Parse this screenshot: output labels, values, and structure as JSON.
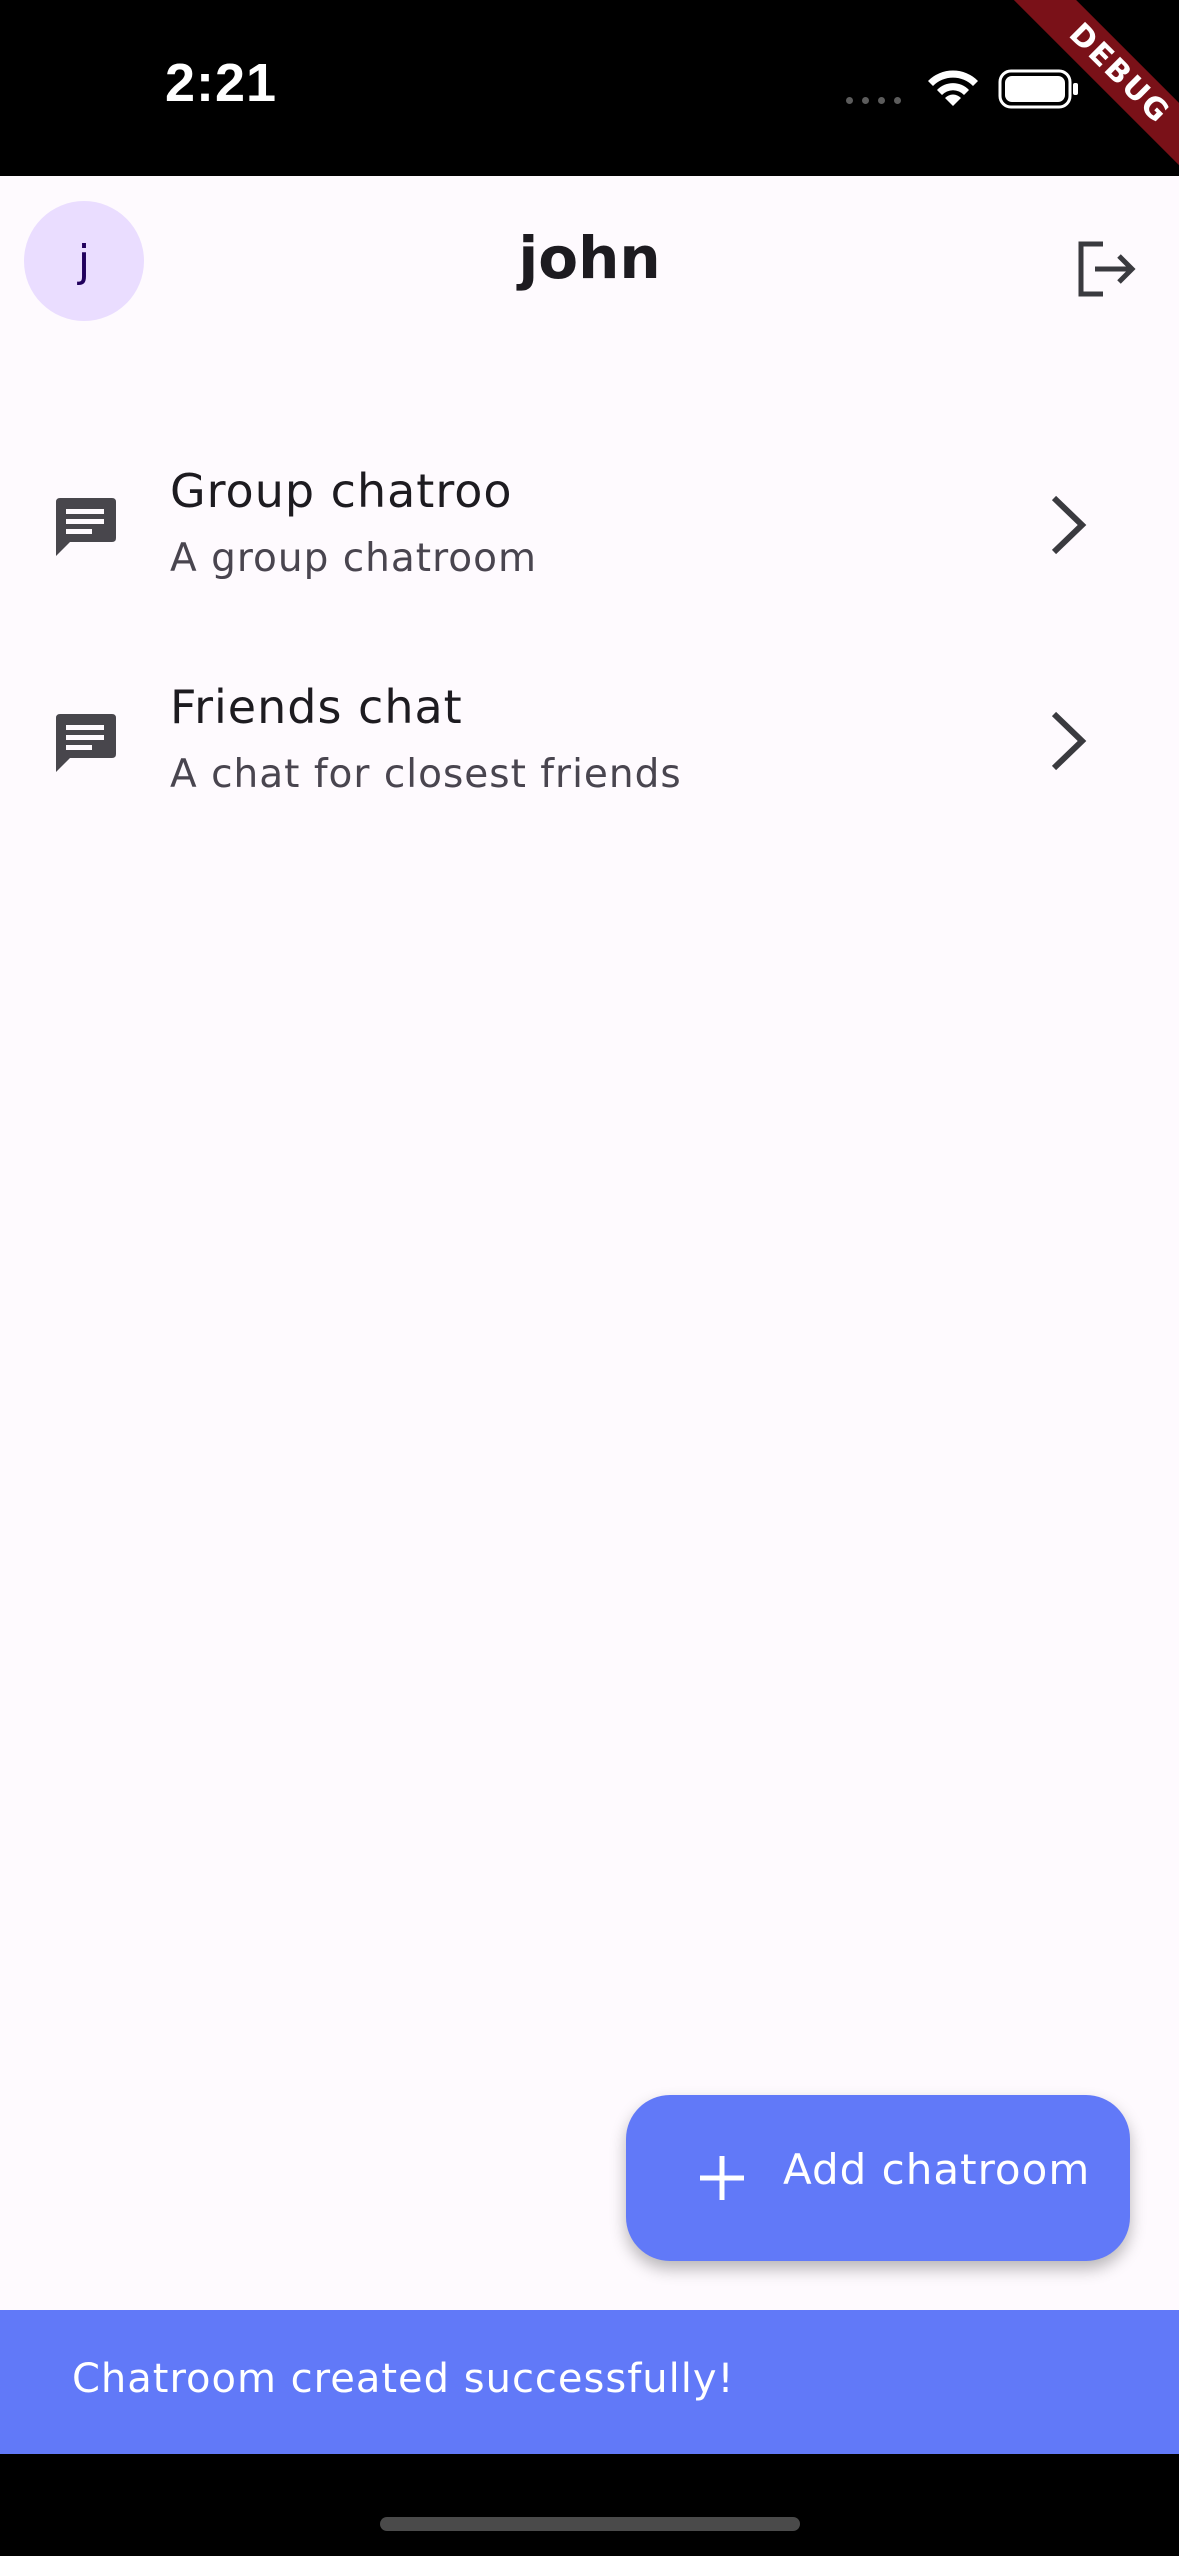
{
  "status_bar": {
    "time": "2:21",
    "debug_label": "DEBUG"
  },
  "app_bar": {
    "avatar_initial": "j",
    "title": "john"
  },
  "chatrooms": [
    {
      "title": "Group chatroo",
      "subtitle": "A group chatroom"
    },
    {
      "title": "Friends chat",
      "subtitle": "A chat for closest friends"
    }
  ],
  "fab": {
    "label": "Add chatroom"
  },
  "snackbar": {
    "message": "Chatroom created successfully!"
  },
  "icons": {
    "status": [
      "cellular-dots-icon",
      "wifi-icon",
      "battery-icon"
    ],
    "app_bar": [
      "logout-icon"
    ],
    "list": [
      "chat-bubble-icon",
      "chevron-right-icon"
    ],
    "fab": [
      "plus-icon"
    ]
  },
  "colors": {
    "background": "#fefafe",
    "accent": "#6179f8",
    "avatar_bg": "#eaddff",
    "text_primary": "#1d1b20",
    "text_secondary": "#49454f",
    "debug_ribbon": "#7a1118"
  }
}
